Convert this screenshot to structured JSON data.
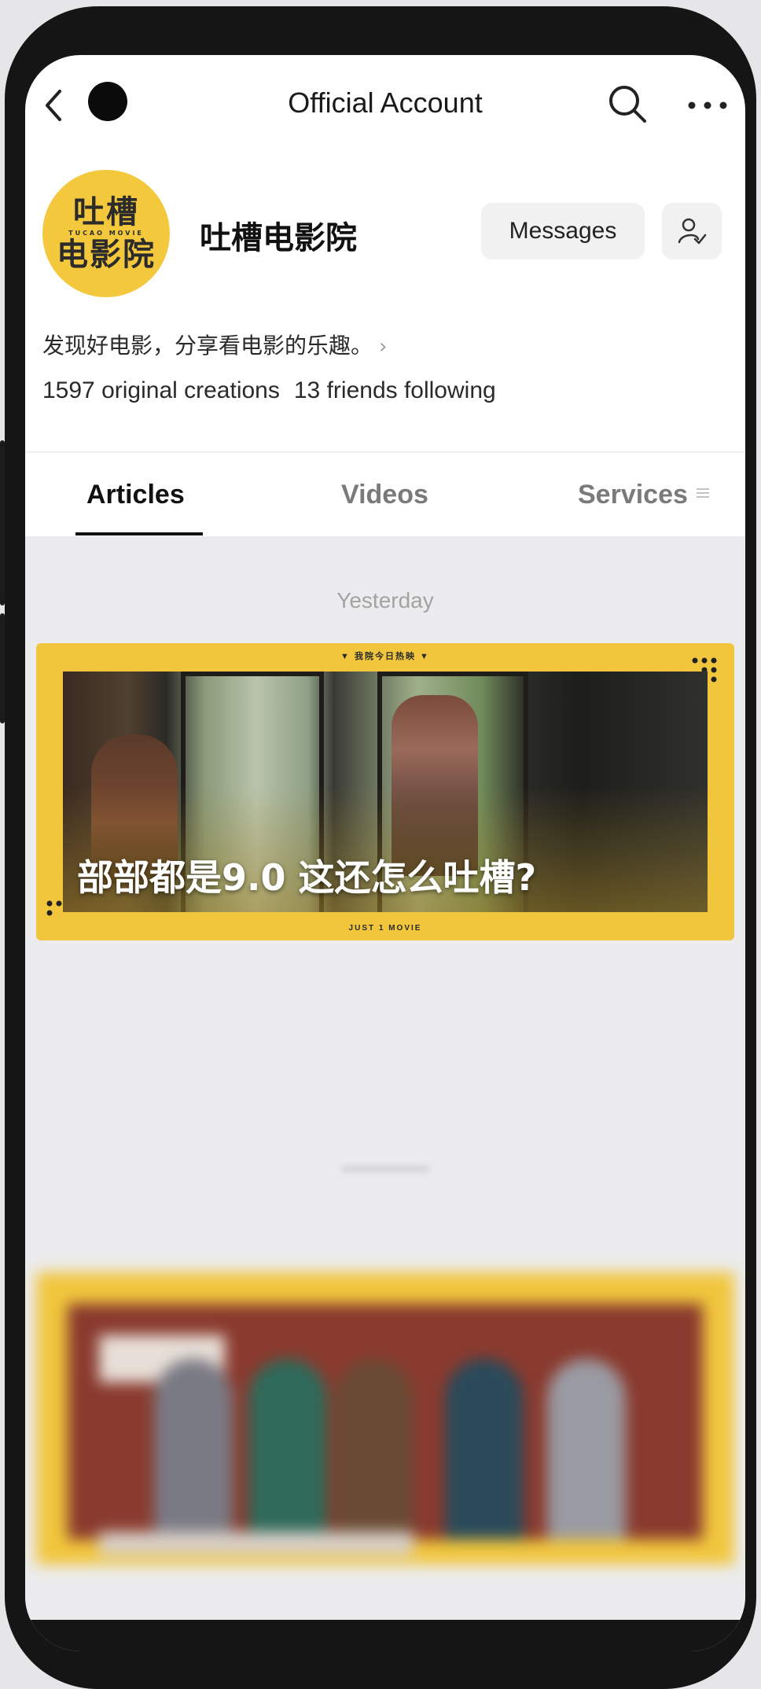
{
  "app_bar": {
    "title": "Official Account"
  },
  "account": {
    "avatar_line1": "吐槽",
    "avatar_small": "TUCAO MOVIE",
    "avatar_line2": "电影院",
    "name": "吐槽电影院",
    "messages_label": "Messages",
    "bio": "发现好电影，分享看电影的乐趣。",
    "original_creations": "1597 original creations",
    "friends_following": "13 friends following"
  },
  "tabs": [
    {
      "label": "Articles",
      "selected": true
    },
    {
      "label": "Videos",
      "selected": false
    },
    {
      "label": "Services",
      "selected": false
    }
  ],
  "feed": {
    "groups": [
      {
        "date": "Yesterday",
        "card": {
          "top_label": "▼ 我院今日热映 ▼",
          "title": "部部都是9.0 这还怎么吐槽?",
          "bottom_label": "JUST 1 MOVIE"
        }
      }
    ]
  },
  "colors": {
    "brand_yellow": "#f1c63d",
    "text_primary": "#111111",
    "text_secondary": "#7a7a7a",
    "feed_background": "#ececee"
  },
  "icons": [
    "back-icon",
    "search-icon",
    "more-icon",
    "follow-icon",
    "chevron-right-icon",
    "menu-icon"
  ]
}
